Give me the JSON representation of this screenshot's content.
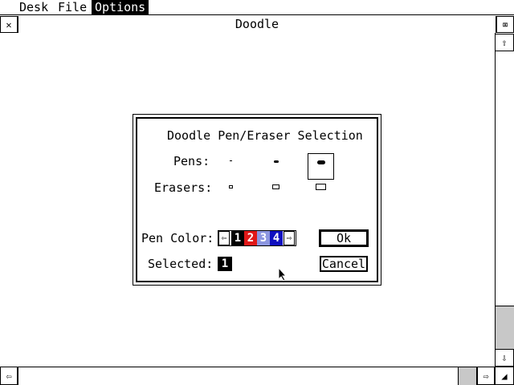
{
  "menubar": {
    "items": [
      {
        "label": "Desk"
      },
      {
        "label": "File"
      },
      {
        "label": "Options"
      }
    ]
  },
  "window": {
    "title": "Doodle",
    "close_glyph": "✕",
    "full_glyph": "⌧"
  },
  "scroll": {
    "up": "⇧",
    "down": "⇩",
    "left": "⇦",
    "right": "⇨",
    "resize": "◢"
  },
  "dialog": {
    "title": "Doodle Pen/Eraser Selection",
    "pens_label": "Pens:",
    "erasers_label": "Erasers:",
    "pen_color_label": "Pen Color:",
    "selected_label": "Selected:",
    "left_arrow": "⇦",
    "right_arrow": "⇨",
    "colors": [
      {
        "label": "1",
        "color": "#000000"
      },
      {
        "label": "2",
        "color": "#e01818"
      },
      {
        "label": "3",
        "color": "#8c96e0"
      },
      {
        "label": "4",
        "color": "#1010c0"
      }
    ],
    "selected_value": "1",
    "ok_label": "Ok",
    "cancel_label": "Cancel"
  }
}
